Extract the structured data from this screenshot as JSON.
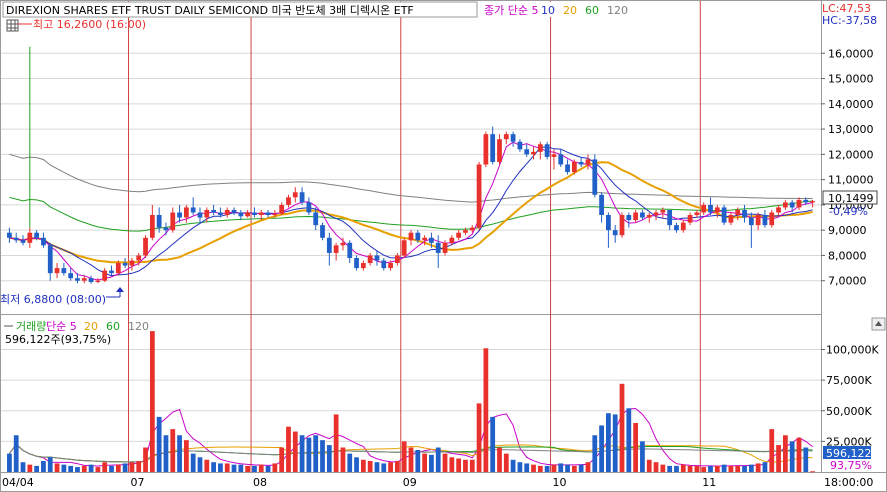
{
  "chart_data": [
    {
      "type": "candlestick",
      "title": "DIREXION SHARES ETF TRUST DAILY SEMICOND  미국 반도체 3배 디렉시온 ETF",
      "legend": [
        {
          "label": "종가 단순 5",
          "color": "#cc00cc"
        },
        {
          "label": "10",
          "color": "#2030c0"
        },
        {
          "label": "20",
          "color": "#e8a000"
        },
        {
          "label": "60",
          "color": "#20a020"
        },
        {
          "label": "120",
          "color": "#808080"
        }
      ],
      "ylim": [
        6000,
        17000
      ],
      "y_ticks": [
        "16,0000",
        "15,0000",
        "14,0000",
        "13,0000",
        "12,0000",
        "11,0000",
        "10,0000",
        "9,0000",
        "8,0000",
        "7,0000"
      ],
      "y_tick_values": [
        16000,
        15000,
        14000,
        13000,
        12000,
        11000,
        10000,
        9000,
        8000,
        7000
      ],
      "high_label": "최고 16,2600 (16:00)",
      "low_label": "최저 6,8800 (08:00)",
      "lc_label": "LC:47,53",
      "hc_label": "HC:-37,58",
      "current_price": "10,1499",
      "current_change": "-0,49%",
      "candles": [
        [
          8900,
          9100,
          8500,
          8700
        ],
        [
          8700,
          8900,
          8500,
          8600
        ],
        [
          8600,
          8800,
          8400,
          8500
        ],
        [
          8500,
          9100,
          8300,
          8900
        ],
        [
          8900,
          9000,
          8600,
          8700
        ],
        [
          8700,
          8900,
          8300,
          8400
        ],
        [
          8400,
          8500,
          7000,
          7300
        ],
        [
          7300,
          7700,
          7100,
          7500
        ],
        [
          7500,
          7700,
          7200,
          7300
        ],
        [
          7300,
          7500,
          7000,
          7100
        ],
        [
          7100,
          7300,
          6900,
          7000
        ],
        [
          7000,
          7200,
          6900,
          7100
        ],
        [
          7100,
          7200,
          6880,
          6950
        ],
        [
          6950,
          7100,
          6900,
          7000
        ],
        [
          7000,
          7500,
          6950,
          7400
        ],
        [
          7400,
          7600,
          7200,
          7300
        ],
        [
          7300,
          7800,
          7200,
          7700
        ],
        [
          7700,
          7900,
          7500,
          7600
        ],
        [
          7600,
          7900,
          7400,
          7800
        ],
        [
          7800,
          8100,
          7600,
          8000
        ],
        [
          8000,
          8800,
          7900,
          8700
        ],
        [
          8700,
          10000,
          8600,
          9600
        ],
        [
          9600,
          9900,
          8900,
          9100
        ],
        [
          9100,
          9300,
          8800,
          9000
        ],
        [
          9000,
          9900,
          8900,
          9700
        ],
        [
          9700,
          10000,
          9300,
          9500
        ],
        [
          9500,
          10000,
          9300,
          9900
        ],
        [
          9900,
          10300,
          9600,
          9700
        ],
        [
          9700,
          9900,
          9300,
          9500
        ],
        [
          9500,
          9900,
          9300,
          9800
        ],
        [
          9800,
          10000,
          9600,
          9700
        ],
        [
          9700,
          9900,
          9500,
          9600
        ],
        [
          9600,
          9900,
          9500,
          9800
        ],
        [
          9800,
          9900,
          9600,
          9700
        ],
        [
          9700,
          9800,
          9400,
          9550
        ],
        [
          9550,
          9800,
          9500,
          9700
        ],
        [
          9700,
          9900,
          9500,
          9600
        ],
        [
          9600,
          9800,
          9400,
          9700
        ],
        [
          9700,
          9800,
          9500,
          9600
        ],
        [
          9600,
          9800,
          9500,
          9650
        ],
        [
          9650,
          10100,
          9600,
          10000
        ],
        [
          10000,
          10400,
          9900,
          10300
        ],
        [
          10300,
          10700,
          10100,
          10500
        ],
        [
          10500,
          10700,
          10000,
          10100
        ],
        [
          10100,
          10300,
          9600,
          9700
        ],
        [
          9700,
          9900,
          9000,
          9200
        ],
        [
          9200,
          9300,
          8600,
          8700
        ],
        [
          8700,
          8900,
          7600,
          8100
        ],
        [
          8100,
          8500,
          7800,
          8400
        ],
        [
          8400,
          8700,
          8200,
          8500
        ],
        [
          8500,
          8600,
          7700,
          7900
        ],
        [
          7900,
          8000,
          7400,
          7500
        ],
        [
          7500,
          7800,
          7400,
          7700
        ],
        [
          7700,
          8100,
          7600,
          8000
        ],
        [
          8000,
          8200,
          7600,
          7800
        ],
        [
          7800,
          7900,
          7400,
          7500
        ],
        [
          7500,
          7800,
          7400,
          7700
        ],
        [
          7700,
          8100,
          7600,
          8000
        ],
        [
          8000,
          8700,
          7900,
          8600
        ],
        [
          8600,
          9000,
          8400,
          8900
        ],
        [
          8900,
          9000,
          8500,
          8600
        ],
        [
          8600,
          8800,
          8400,
          8700
        ],
        [
          8700,
          8900,
          8300,
          8500
        ],
        [
          8500,
          8800,
          7500,
          8100
        ],
        [
          8100,
          8600,
          8000,
          8500
        ],
        [
          8500,
          8800,
          8400,
          8700
        ],
        [
          8700,
          9000,
          8600,
          8900
        ],
        [
          8900,
          9100,
          8800,
          9000
        ],
        [
          9000,
          9200,
          8900,
          9100
        ],
        [
          9100,
          11700,
          9000,
          11600
        ],
        [
          11600,
          12900,
          11500,
          12800
        ],
        [
          12800,
          13100,
          11600,
          11700
        ],
        [
          11700,
          12800,
          11600,
          12600
        ],
        [
          12600,
          12900,
          12400,
          12800
        ],
        [
          12800,
          12900,
          12300,
          12500
        ],
        [
          12500,
          12600,
          12100,
          12200
        ],
        [
          12200,
          12400,
          11900,
          12000
        ],
        [
          12000,
          12300,
          11800,
          12100
        ],
        [
          12100,
          12500,
          11800,
          12400
        ],
        [
          12400,
          12500,
          11800,
          11900
        ],
        [
          11900,
          12200,
          11400,
          12000
        ],
        [
          12000,
          12200,
          11500,
          11600
        ],
        [
          11600,
          11800,
          11200,
          11300
        ],
        [
          11300,
          11800,
          11200,
          11700
        ],
        [
          11700,
          11900,
          11500,
          11600
        ],
        [
          11600,
          12000,
          11400,
          11800
        ],
        [
          11800,
          12000,
          10300,
          10400
        ],
        [
          10400,
          10500,
          9300,
          9600
        ],
        [
          9600,
          9700,
          8300,
          9000
        ],
        [
          9000,
          9200,
          8500,
          8800
        ],
        [
          8800,
          9700,
          8700,
          9600
        ],
        [
          9600,
          9700,
          9100,
          9400
        ],
        [
          9400,
          9800,
          9300,
          9700
        ],
        [
          9700,
          9800,
          9400,
          9500
        ],
        [
          9500,
          9700,
          9300,
          9600
        ],
        [
          9600,
          9800,
          9400,
          9700
        ],
        [
          9700,
          9900,
          9500,
          9800
        ],
        [
          9800,
          9800,
          9000,
          9200
        ],
        [
          9200,
          9300,
          8900,
          9000
        ],
        [
          9000,
          9400,
          8900,
          9300
        ],
        [
          9300,
          9700,
          9200,
          9600
        ],
        [
          9600,
          9800,
          9500,
          9700
        ],
        [
          9700,
          10100,
          9600,
          10000
        ],
        [
          10000,
          10300,
          9600,
          9700
        ],
        [
          9700,
          10000,
          9500,
          9900
        ],
        [
          9900,
          10000,
          9200,
          9300
        ],
        [
          9300,
          9700,
          9200,
          9600
        ],
        [
          9600,
          9900,
          9400,
          9800
        ],
        [
          9800,
          10000,
          9300,
          9500
        ],
        [
          9500,
          9700,
          8300,
          9200
        ],
        [
          9200,
          9700,
          9000,
          9600
        ],
        [
          9600,
          9800,
          9100,
          9200
        ],
        [
          9200,
          9800,
          9100,
          9700
        ],
        [
          9700,
          10000,
          9600,
          9900
        ],
        [
          9900,
          10200,
          9800,
          10100
        ],
        [
          10100,
          10200,
          9700,
          9900
        ],
        [
          9900,
          10300,
          9800,
          10200
        ],
        [
          10200,
          10300,
          10000,
          10100
        ],
        [
          10100,
          10200,
          9900,
          10150
        ]
      ]
    },
    {
      "type": "bar",
      "title": "거래량",
      "legend": [
        {
          "label": "거래량",
          "color": "#20a020"
        },
        {
          "label": "단순 5",
          "color": "#cc00cc"
        },
        {
          "label": "20",
          "color": "#e8a000"
        },
        {
          "label": "60",
          "color": "#20a020"
        },
        {
          "label": "120",
          "color": "#808080"
        }
      ],
      "ylim": [
        0,
        120000
      ],
      "y_ticks": [
        "100,000K",
        "75,000K",
        "50,000K",
        "25,000K"
      ],
      "y_tick_values": [
        100000,
        75000,
        50000,
        25000
      ],
      "info_label": "596,122주(93,75%)",
      "current_volume": "596,122",
      "current_ratio": "93,75%",
      "volumes": [
        15000,
        30000,
        8000,
        6000,
        5000,
        9000,
        12000,
        7000,
        6000,
        5000,
        4000,
        5000,
        6000,
        4000,
        8000,
        5000,
        6000,
        7000,
        8000,
        9000,
        20000,
        115000,
        45000,
        30000,
        35000,
        30000,
        26000,
        15000,
        12000,
        10000,
        8000,
        7000,
        7000,
        6000,
        6000,
        5000,
        5000,
        6000,
        5000,
        7000,
        20000,
        37000,
        33000,
        30000,
        28000,
        30000,
        26000,
        22000,
        47000,
        20000,
        15000,
        12000,
        10000,
        9000,
        8000,
        7000,
        8000,
        9000,
        25000,
        20000,
        18000,
        15000,
        14000,
        20000,
        15000,
        12000,
        11000,
        10000,
        10000,
        56000,
        101000,
        45000,
        20000,
        15000,
        10000,
        8000,
        7000,
        6000,
        5000,
        5000,
        6000,
        7000,
        6000,
        5000,
        6000,
        8000,
        30000,
        38000,
        48000,
        47000,
        72000,
        52000,
        40000,
        25000,
        10000,
        8000,
        6000,
        5000,
        5000,
        6000,
        5000,
        5000,
        4000,
        5000,
        5000,
        6000,
        5000,
        5000,
        5000,
        6000,
        7000,
        8000,
        35000,
        22000,
        30000,
        25000,
        28000,
        20000,
        596
      ]
    }
  ],
  "x_axis": {
    "labels": [
      "04/04",
      "07",
      "08",
      "09",
      "10",
      "11",
      "18:00:00"
    ],
    "month_start_index": [
      0,
      18,
      36,
      58,
      80,
      102
    ]
  },
  "colors": {
    "up": "#e8302c",
    "down": "#2060c8",
    "separator": "#d04040",
    "grid": "#d8d8d8",
    "ma5": "#cc00cc",
    "ma10": "#2030c0",
    "ma20": "#e8a000",
    "ma60": "#20a020",
    "ma120": "#808080"
  },
  "icons": [
    "chart-menu-icon",
    "arrow-up-icon",
    "scrollbar-arrow-icon"
  ]
}
